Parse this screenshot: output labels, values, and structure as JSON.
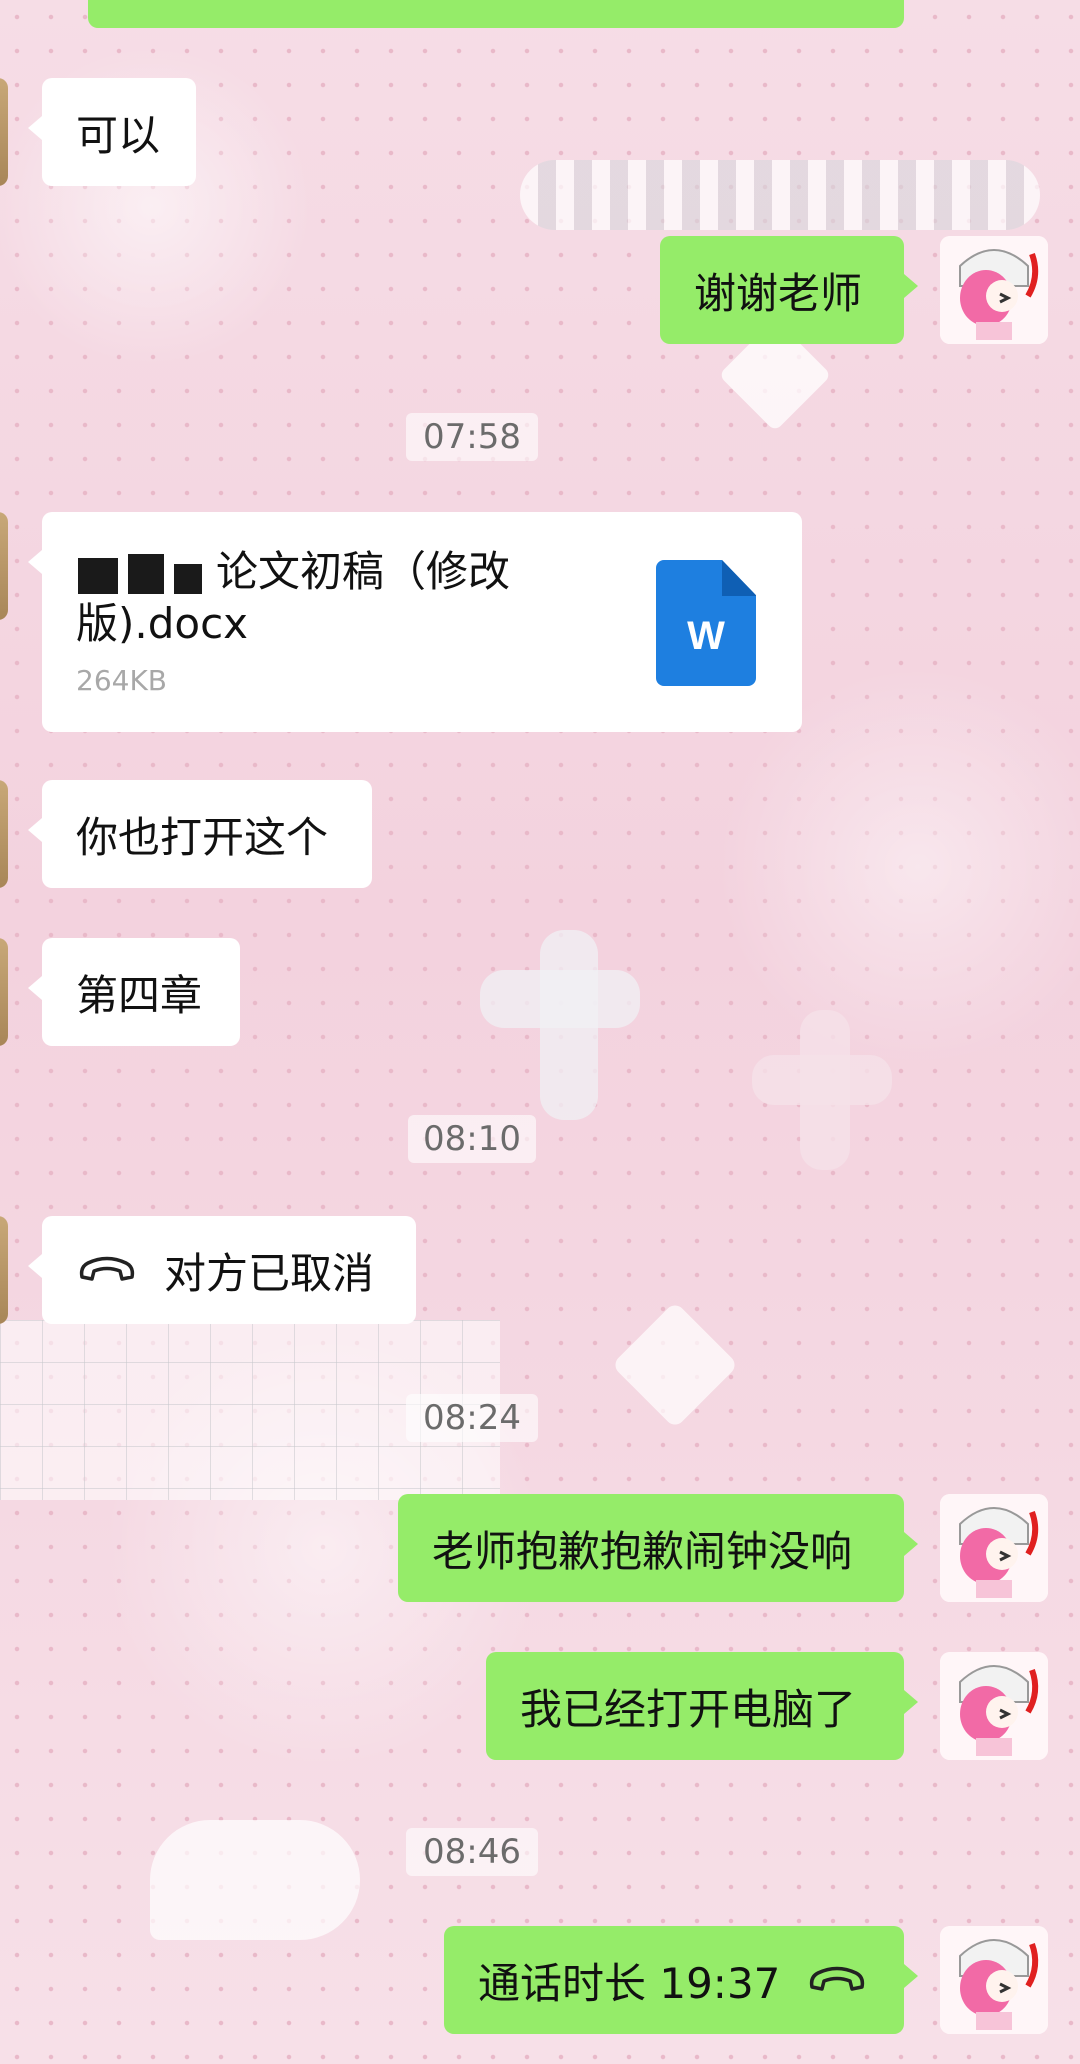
{
  "messages": {
    "m1": {
      "text": "可以"
    },
    "m2": {
      "text": "谢谢老师"
    },
    "m3": {
      "file_name": "论文初稿（修改版).docx",
      "file_size": "264KB",
      "file_icon_letter": "W"
    },
    "m4": {
      "text": "你也打开这个"
    },
    "m5": {
      "text": "第四章"
    },
    "m6": {
      "text": "对方已取消",
      "icon": "phone-hangup-icon"
    },
    "m7": {
      "text": "老师抱歉抱歉闹钟没响"
    },
    "m8": {
      "text": "我已经打开电脑了"
    },
    "m9": {
      "text": "通话时长 19:37",
      "icon": "phone-hangup-icon"
    }
  },
  "timestamps": {
    "t1": "07:58",
    "t2": "08:10",
    "t3": "08:24",
    "t4": "08:46"
  },
  "colors": {
    "outgoing_bubble": "#95ec69",
    "incoming_bubble": "#ffffff",
    "word_icon": "#1e7fe0",
    "background": "#f5d9e3"
  }
}
